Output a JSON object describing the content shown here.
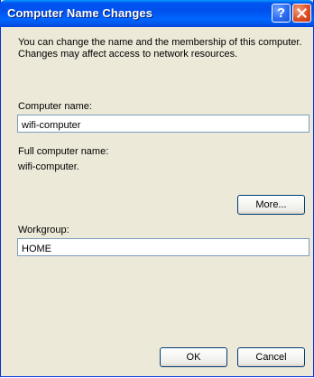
{
  "window": {
    "title": "Computer Name Changes",
    "help_label": "?"
  },
  "description": "You can change the name and the membership of this computer. Changes may affect access to network resources.",
  "computer_name": {
    "label": "Computer name:",
    "value": "wifi-computer"
  },
  "full_computer_name": {
    "label": "Full computer name:",
    "value": "wifi-computer."
  },
  "more_button": "More...",
  "workgroup": {
    "label": "Workgroup:",
    "value": "HOME"
  },
  "ok_button": "OK",
  "cancel_button": "Cancel",
  "colors": {
    "titlebar": "#0055ea",
    "window_bg": "#ece9d8",
    "field_border": "#7f9db9",
    "close_button": "#df4f25"
  },
  "icons": {
    "help": "help-icon",
    "close": "close-icon"
  }
}
